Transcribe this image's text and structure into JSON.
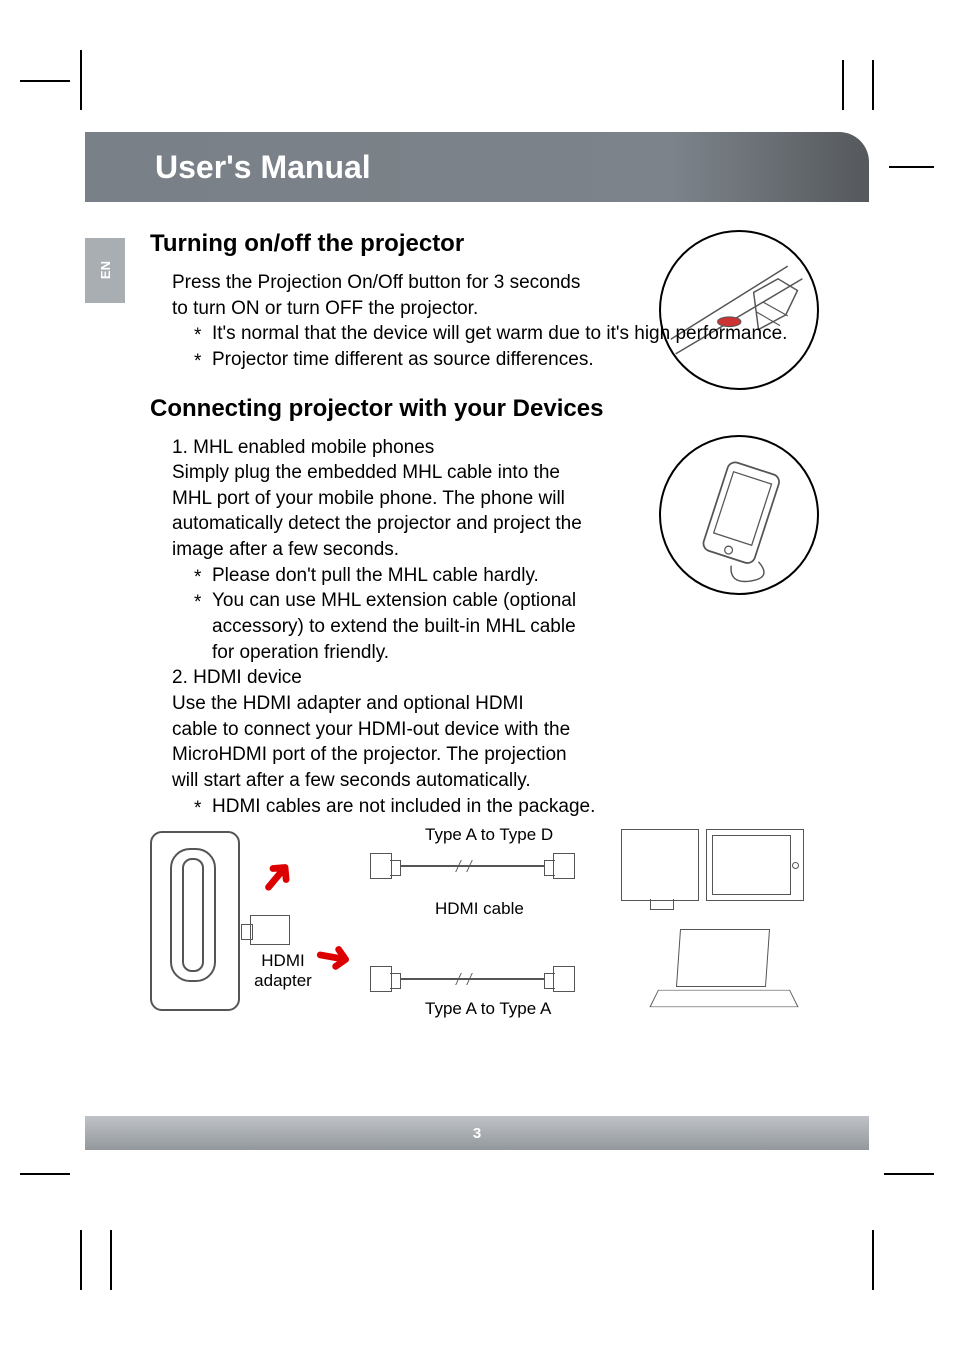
{
  "header": {
    "title": "User's Manual"
  },
  "lang_tab": "EN",
  "section1": {
    "heading": "Turning on/off the projector",
    "intro": "Press the Projection On/Off button for 3 seconds to turn ON or turn OFF the projector.",
    "bullets": [
      "It's normal that the device will get warm due to it's high performance.",
      "Projector time different as source differences."
    ]
  },
  "section2": {
    "heading": "Connecting projector with your Devices",
    "item1_title": "1. MHL enabled mobile phones",
    "item1_body": "Simply plug the embedded MHL cable into the MHL port of your mobile phone. The phone will automatically detect the projector and project the image after a few seconds.",
    "item1_bullets": [
      "Please don't pull the MHL cable hardly.",
      "You can use MHL extension cable (optional accessory) to extend the built-in MHL cable for operation friendly."
    ],
    "item2_title": "2. HDMI device",
    "item2_body": "Use the HDMI adapter and optional HDMI cable to connect your HDMI-out device with the MicroHDMI port of the projector. The projection will start after a few seconds automatically.",
    "item2_bullets": [
      "HDMI cables are not included in the package."
    ]
  },
  "diagram": {
    "hdmi_adapter": "HDMI adapter",
    "type_a_d": "Type A to Type D",
    "hdmi_cable": "HDMI cable",
    "type_a_a": "Type A to Type A"
  },
  "footer": {
    "page": "3"
  }
}
